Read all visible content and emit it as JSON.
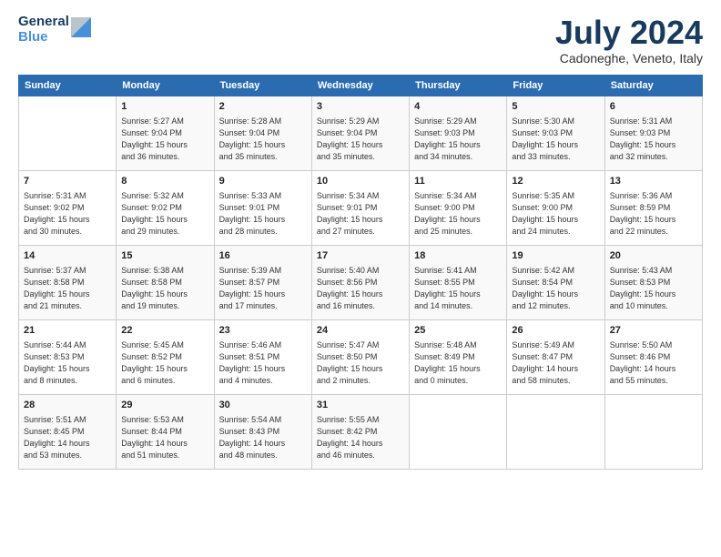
{
  "header": {
    "logo_line1": "General",
    "logo_line2": "Blue",
    "month_title": "July 2024",
    "location": "Cadoneghe, Veneto, Italy"
  },
  "weekdays": [
    "Sunday",
    "Monday",
    "Tuesday",
    "Wednesday",
    "Thursday",
    "Friday",
    "Saturday"
  ],
  "weeks": [
    [
      {
        "num": "",
        "info": ""
      },
      {
        "num": "1",
        "info": "Sunrise: 5:27 AM\nSunset: 9:04 PM\nDaylight: 15 hours\nand 36 minutes."
      },
      {
        "num": "2",
        "info": "Sunrise: 5:28 AM\nSunset: 9:04 PM\nDaylight: 15 hours\nand 35 minutes."
      },
      {
        "num": "3",
        "info": "Sunrise: 5:29 AM\nSunset: 9:04 PM\nDaylight: 15 hours\nand 35 minutes."
      },
      {
        "num": "4",
        "info": "Sunrise: 5:29 AM\nSunset: 9:03 PM\nDaylight: 15 hours\nand 34 minutes."
      },
      {
        "num": "5",
        "info": "Sunrise: 5:30 AM\nSunset: 9:03 PM\nDaylight: 15 hours\nand 33 minutes."
      },
      {
        "num": "6",
        "info": "Sunrise: 5:31 AM\nSunset: 9:03 PM\nDaylight: 15 hours\nand 32 minutes."
      }
    ],
    [
      {
        "num": "7",
        "info": "Sunrise: 5:31 AM\nSunset: 9:02 PM\nDaylight: 15 hours\nand 30 minutes."
      },
      {
        "num": "8",
        "info": "Sunrise: 5:32 AM\nSunset: 9:02 PM\nDaylight: 15 hours\nand 29 minutes."
      },
      {
        "num": "9",
        "info": "Sunrise: 5:33 AM\nSunset: 9:01 PM\nDaylight: 15 hours\nand 28 minutes."
      },
      {
        "num": "10",
        "info": "Sunrise: 5:34 AM\nSunset: 9:01 PM\nDaylight: 15 hours\nand 27 minutes."
      },
      {
        "num": "11",
        "info": "Sunrise: 5:34 AM\nSunset: 9:00 PM\nDaylight: 15 hours\nand 25 minutes."
      },
      {
        "num": "12",
        "info": "Sunrise: 5:35 AM\nSunset: 9:00 PM\nDaylight: 15 hours\nand 24 minutes."
      },
      {
        "num": "13",
        "info": "Sunrise: 5:36 AM\nSunset: 8:59 PM\nDaylight: 15 hours\nand 22 minutes."
      }
    ],
    [
      {
        "num": "14",
        "info": "Sunrise: 5:37 AM\nSunset: 8:58 PM\nDaylight: 15 hours\nand 21 minutes."
      },
      {
        "num": "15",
        "info": "Sunrise: 5:38 AM\nSunset: 8:58 PM\nDaylight: 15 hours\nand 19 minutes."
      },
      {
        "num": "16",
        "info": "Sunrise: 5:39 AM\nSunset: 8:57 PM\nDaylight: 15 hours\nand 17 minutes."
      },
      {
        "num": "17",
        "info": "Sunrise: 5:40 AM\nSunset: 8:56 PM\nDaylight: 15 hours\nand 16 minutes."
      },
      {
        "num": "18",
        "info": "Sunrise: 5:41 AM\nSunset: 8:55 PM\nDaylight: 15 hours\nand 14 minutes."
      },
      {
        "num": "19",
        "info": "Sunrise: 5:42 AM\nSunset: 8:54 PM\nDaylight: 15 hours\nand 12 minutes."
      },
      {
        "num": "20",
        "info": "Sunrise: 5:43 AM\nSunset: 8:53 PM\nDaylight: 15 hours\nand 10 minutes."
      }
    ],
    [
      {
        "num": "21",
        "info": "Sunrise: 5:44 AM\nSunset: 8:53 PM\nDaylight: 15 hours\nand 8 minutes."
      },
      {
        "num": "22",
        "info": "Sunrise: 5:45 AM\nSunset: 8:52 PM\nDaylight: 15 hours\nand 6 minutes."
      },
      {
        "num": "23",
        "info": "Sunrise: 5:46 AM\nSunset: 8:51 PM\nDaylight: 15 hours\nand 4 minutes."
      },
      {
        "num": "24",
        "info": "Sunrise: 5:47 AM\nSunset: 8:50 PM\nDaylight: 15 hours\nand 2 minutes."
      },
      {
        "num": "25",
        "info": "Sunrise: 5:48 AM\nSunset: 8:49 PM\nDaylight: 15 hours\nand 0 minutes."
      },
      {
        "num": "26",
        "info": "Sunrise: 5:49 AM\nSunset: 8:47 PM\nDaylight: 14 hours\nand 58 minutes."
      },
      {
        "num": "27",
        "info": "Sunrise: 5:50 AM\nSunset: 8:46 PM\nDaylight: 14 hours\nand 55 minutes."
      }
    ],
    [
      {
        "num": "28",
        "info": "Sunrise: 5:51 AM\nSunset: 8:45 PM\nDaylight: 14 hours\nand 53 minutes."
      },
      {
        "num": "29",
        "info": "Sunrise: 5:53 AM\nSunset: 8:44 PM\nDaylight: 14 hours\nand 51 minutes."
      },
      {
        "num": "30",
        "info": "Sunrise: 5:54 AM\nSunset: 8:43 PM\nDaylight: 14 hours\nand 48 minutes."
      },
      {
        "num": "31",
        "info": "Sunrise: 5:55 AM\nSunset: 8:42 PM\nDaylight: 14 hours\nand 46 minutes."
      },
      {
        "num": "",
        "info": ""
      },
      {
        "num": "",
        "info": ""
      },
      {
        "num": "",
        "info": ""
      }
    ]
  ]
}
